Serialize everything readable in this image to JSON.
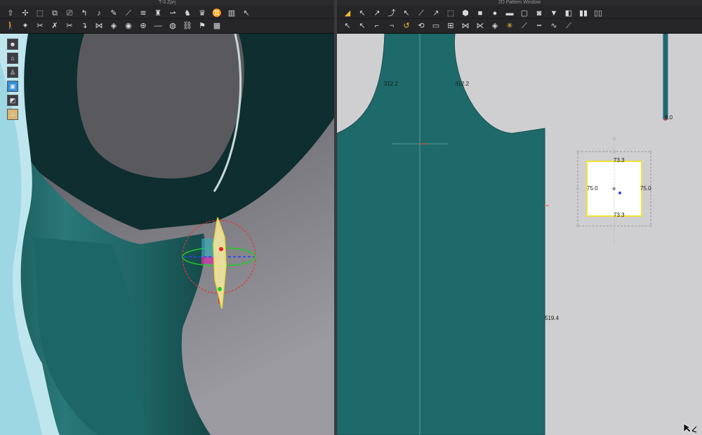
{
  "window": {
    "file_title": "T-3.Zprj",
    "pattern_title": "2D Pattern Window"
  },
  "left_toolbar_row1": [
    {
      "name": "select-move-icon",
      "glyph": "⇧"
    },
    {
      "name": "move-axis-icon",
      "glyph": "✢"
    },
    {
      "name": "box-select-icon",
      "glyph": "⬚"
    },
    {
      "name": "transform-box-icon",
      "glyph": "⧉"
    },
    {
      "name": "camera-icon",
      "glyph": "⎚"
    },
    {
      "name": "fold-icon",
      "glyph": "↰"
    },
    {
      "name": "tape-icon",
      "glyph": "♪"
    },
    {
      "name": "pin-icon",
      "glyph": "✎"
    },
    {
      "name": "brush-icon",
      "glyph": "⟋"
    },
    {
      "name": "steam-icon",
      "glyph": "≋"
    },
    {
      "name": "shirt-icon",
      "glyph": "♜"
    },
    {
      "name": "arrange-icon",
      "glyph": "⇀"
    },
    {
      "name": "avatar-sit-icon",
      "glyph": "♞"
    },
    {
      "name": "hanger-icon",
      "glyph": "♛"
    },
    {
      "name": "book-icon",
      "glyph": "♊"
    },
    {
      "name": "book-open-icon",
      "glyph": "▥"
    },
    {
      "name": "needle-icon",
      "glyph": "↖"
    }
  ],
  "left_toolbar_row2": [
    {
      "name": "walk-icon",
      "glyph": "🚶"
    },
    {
      "name": "puppet-icon",
      "glyph": "✦"
    },
    {
      "name": "scissors-icon",
      "glyph": "✂"
    },
    {
      "name": "pinch-icon",
      "glyph": "✗"
    },
    {
      "name": "trim-icon",
      "glyph": "✂"
    },
    {
      "name": "fit-icon",
      "glyph": "↴"
    },
    {
      "name": "stitch-icon",
      "glyph": "⋈"
    },
    {
      "name": "diamond-icon",
      "glyph": "◈"
    },
    {
      "name": "button-icon",
      "glyph": "◉"
    },
    {
      "name": "buttonhole-icon",
      "glyph": "⊕"
    },
    {
      "name": "line-icon",
      "glyph": "—"
    },
    {
      "name": "gauge-icon",
      "glyph": "◍"
    },
    {
      "name": "zipper-icon",
      "glyph": "⛓"
    },
    {
      "name": "flag-icon",
      "glyph": "⚑"
    },
    {
      "name": "pattern-piece-icon",
      "glyph": "▦"
    }
  ],
  "right_toolbar_row1": [
    {
      "name": "edit-pattern-icon",
      "glyph": "◢",
      "accent": true
    },
    {
      "name": "edit-point-icon",
      "glyph": "↖"
    },
    {
      "name": "edit-curve-icon",
      "glyph": "↗"
    },
    {
      "name": "curve-point-icon",
      "glyph": "⤴"
    },
    {
      "name": "free-curve-icon",
      "glyph": "↖"
    },
    {
      "name": "segment-icon",
      "glyph": "⟋"
    },
    {
      "name": "add-point-icon",
      "glyph": "↗"
    },
    {
      "name": "transform-pattern-icon",
      "glyph": "⬚"
    },
    {
      "name": "polygon-icon",
      "glyph": "⬢"
    },
    {
      "name": "rectangle-icon",
      "glyph": "■"
    },
    {
      "name": "circle-icon",
      "glyph": "●"
    },
    {
      "name": "internal-rectangle-icon",
      "glyph": "▬"
    },
    {
      "name": "internal-rounded-rect-icon",
      "glyph": "▢"
    },
    {
      "name": "internal-circle-icon",
      "glyph": "◙"
    },
    {
      "name": "dart-icon",
      "glyph": "▼"
    },
    {
      "name": "shirring-icon",
      "glyph": "◧"
    },
    {
      "name": "elastic-icon",
      "glyph": "▮▮"
    },
    {
      "name": "fold-arrange-icon",
      "glyph": "▯▯"
    }
  ],
  "right_toolbar_row2": [
    {
      "name": "select-seam-icon",
      "glyph": "↖"
    },
    {
      "name": "segment-sewing-icon",
      "glyph": "↖"
    },
    {
      "name": "free-sewing-icon",
      "glyph": "⌐"
    },
    {
      "name": "check-sewing-icon",
      "glyph": "¬"
    },
    {
      "name": "tack-icon",
      "glyph": "↺",
      "accent": true
    },
    {
      "name": "tack-edit-icon",
      "glyph": "⟲"
    },
    {
      "name": "trace-icon",
      "glyph": "▭"
    },
    {
      "name": "pleat-icon",
      "glyph": "⊞"
    },
    {
      "name": "stitch-segment-icon",
      "glyph": "⋈"
    },
    {
      "name": "topstitch-icon",
      "glyph": "⋉"
    },
    {
      "name": "puckering-icon",
      "glyph": "◈"
    },
    {
      "name": "graphic-icon",
      "glyph": "✳",
      "accent": true
    },
    {
      "name": "ruler-icon",
      "glyph": "⟋"
    },
    {
      "name": "dashed-ruler-icon",
      "glyph": "┅"
    },
    {
      "name": "wave-icon",
      "glyph": "∿"
    },
    {
      "name": "measure-curve-icon",
      "glyph": "⟋"
    }
  ],
  "side_tools": [
    {
      "name": "avatar-view-icon",
      "glyph": "☻"
    },
    {
      "name": "arrangement-icon",
      "glyph": "⌂"
    },
    {
      "name": "person-icon",
      "glyph": "♙"
    },
    {
      "name": "texture-view-icon",
      "glyph": "▣",
      "state": "active"
    },
    {
      "name": "render-icon",
      "glyph": "◩"
    },
    {
      "name": "face-icon",
      "glyph": "☺",
      "state": "face"
    }
  ],
  "measurements": {
    "armhole_left": "312.2",
    "armhole_right": "312.2",
    "side_length": "519.4",
    "strap_end": "8.0",
    "rect_top": "73.3",
    "rect_bottom": "73.3",
    "rect_left": "75.0",
    "rect_right": "75.0"
  },
  "colors": {
    "fabric": "#1e6a6a",
    "fabric_dark": "#0f3a3c",
    "pattern_bg": "#cfcfd1",
    "viewport_bg": "#6e6e74",
    "selection": "#f2e23a"
  }
}
